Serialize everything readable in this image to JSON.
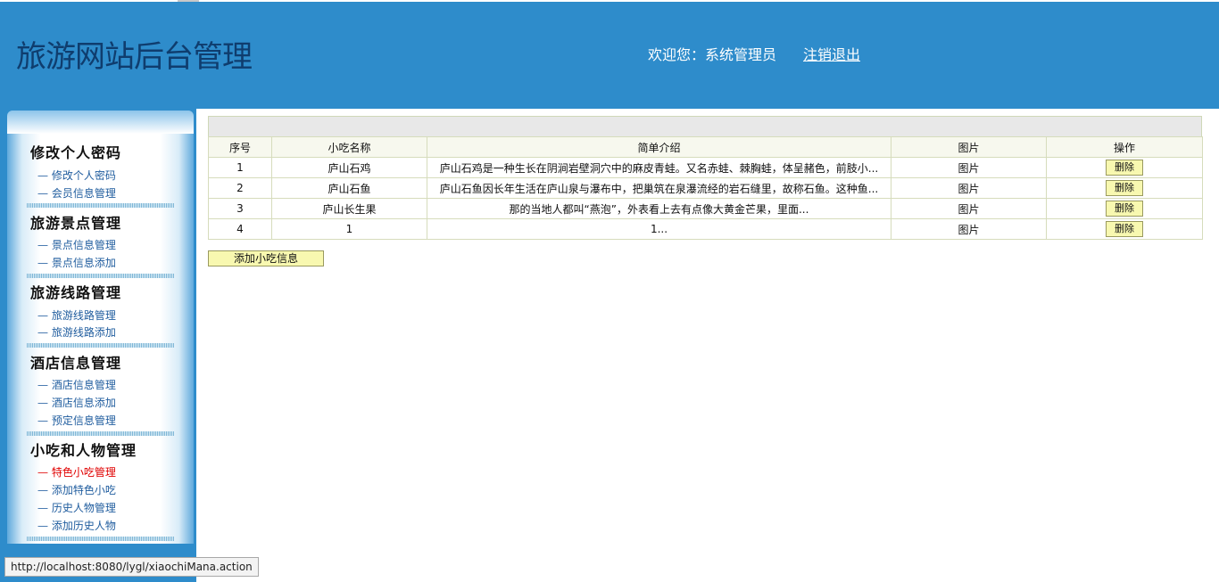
{
  "header": {
    "title": "旅游网站后台管理",
    "welcome": "欢迎您：系统管理员",
    "logout": "注销退出"
  },
  "sidebar": {
    "sections": [
      {
        "title": "修改个人密码",
        "items": [
          "修改个人密码",
          "会员信息管理"
        ]
      },
      {
        "title": "旅游景点管理",
        "items": [
          "景点信息管理",
          "景点信息添加"
        ]
      },
      {
        "title": "旅游线路管理",
        "items": [
          "旅游线路管理",
          "旅游线路添加"
        ]
      },
      {
        "title": "酒店信息管理",
        "items": [
          "酒店信息管理",
          "酒店信息添加",
          "预定信息管理"
        ]
      },
      {
        "title": "小吃和人物管理",
        "items": [
          "特色小吃管理",
          "添加特色小吃",
          "历史人物管理",
          "添加历史人物"
        ]
      }
    ],
    "active_item": "特色小吃管理"
  },
  "table": {
    "columns": [
      "序号",
      "小吃名称",
      "简单介绍",
      "图片",
      "操作"
    ],
    "rows": [
      {
        "no": "1",
        "name": "庐山石鸡",
        "intro": "庐山石鸡是一种生长在阴涧岩壁洞穴中的麻皮青蛙。又名赤蛙、棘胸蛙，体呈赭色，前肢小...",
        "image": "图片",
        "action": "删除"
      },
      {
        "no": "2",
        "name": "庐山石鱼",
        "intro": "庐山石鱼因长年生活在庐山泉与瀑布中，把巢筑在泉瀑流经的岩石缝里，故称石鱼。这种鱼...",
        "image": "图片",
        "action": "删除"
      },
      {
        "no": "3",
        "name": "庐山长生果",
        "intro": "那的当地人都叫“燕泡”，外表看上去有点像大黄金芒果，里面...",
        "image": "图片",
        "action": "删除"
      },
      {
        "no": "4",
        "name": "1",
        "intro": "1...",
        "image": "图片",
        "action": "删除"
      }
    ]
  },
  "add_button": "添加小吃信息",
  "status_bar": "http://localhost:8080/lygl/xiaochiMana.action",
  "colors": {
    "header_bg": "#2e8ccb",
    "title": "#0f3d6e",
    "menu_link": "#1f5c9e",
    "active_link": "#e00000",
    "button_bg": "#f8f8b0"
  }
}
